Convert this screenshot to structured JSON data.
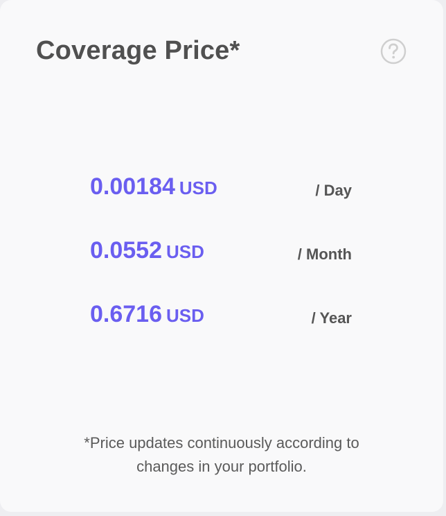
{
  "card": {
    "title": "Coverage Price*",
    "help_icon": "question-circle-icon",
    "prices": [
      {
        "amount": "0.00184",
        "unit": "USD",
        "period": "/ Day"
      },
      {
        "amount": "0.0552",
        "unit": "USD",
        "period": "/ Month"
      },
      {
        "amount": "0.6716",
        "unit": "USD",
        "period": "/ Year"
      }
    ],
    "footnote_line1": "*Price updates continuously according to",
    "footnote_line2": "changes in your portfolio."
  },
  "colors": {
    "accent": "#6a5ef0",
    "title": "#505050",
    "card_bg": "#f9f9fa",
    "page_bg": "#eeeef1"
  }
}
